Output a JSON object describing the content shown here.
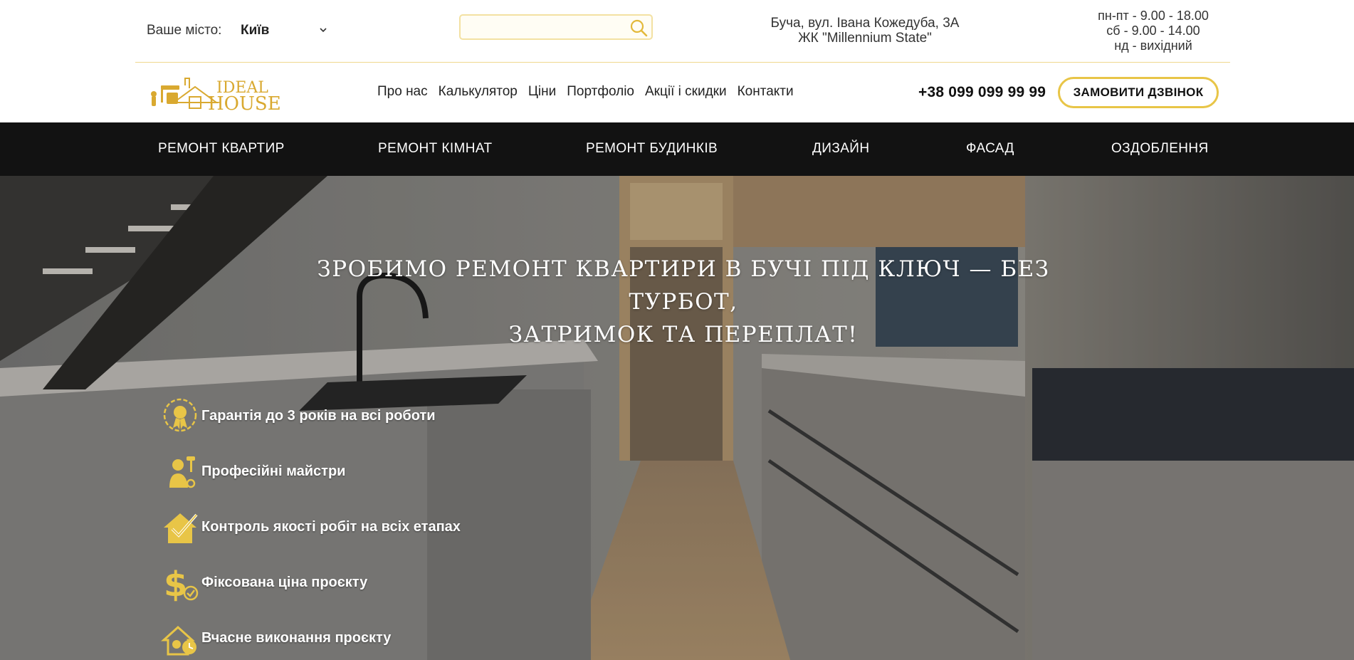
{
  "header": {
    "city_label": "Ваше місто:",
    "city_value": "Київ",
    "search": {
      "placeholder": ""
    },
    "address_line1": "Буча, вул. Івана Кожедуба, 3А",
    "address_line2": "ЖК \"Millennium State\"",
    "hours": [
      "пн-пт - 9.00 - 18.00",
      "сб - 9.00 - 14.00",
      "нд - вихідний"
    ],
    "logo_text_1": "IDEAL",
    "logo_text_2": "HOUSE",
    "menu": [
      "Про нас",
      "Калькулятор",
      "Ціни",
      "Портфоліо",
      "Акції і скидки",
      "Контакти"
    ],
    "phone": "+38 099 099 99 99",
    "call_button": "ЗАМОВИТИ ДЗВІНОК"
  },
  "categories": [
    "РЕМОНТ КВАРТИР",
    "РЕМОНТ КІМНАТ",
    "РЕМОНТ БУДИНКІВ",
    "ДИЗАЙН",
    "ФАСАД",
    "ОЗДОБЛЕННЯ"
  ],
  "hero": {
    "title_line1": "ЗРОБИМО РЕМОНТ КВАРТИРИ В БУЧІ ПІД КЛЮЧ — БЕЗ ТУРБОТ,",
    "title_line2": "ЗАТРИМОК ТА ПЕРЕПЛАТ!",
    "features": [
      {
        "icon": "medal-icon",
        "text": "Гарантія до 3 років на всі роботи"
      },
      {
        "icon": "worker-icon",
        "text": "Професійні майстри"
      },
      {
        "icon": "house-check-icon",
        "text": "Контроль якості робіт на всіх етапах"
      },
      {
        "icon": "dollar-check-icon",
        "text": "Фіксована ціна проєкту"
      },
      {
        "icon": "house-clock-icon",
        "text": "Вчасне виконання проєкту"
      }
    ]
  },
  "colors": {
    "accent": "#e8c547",
    "dark_bar": "#121212",
    "text": "#222222"
  }
}
